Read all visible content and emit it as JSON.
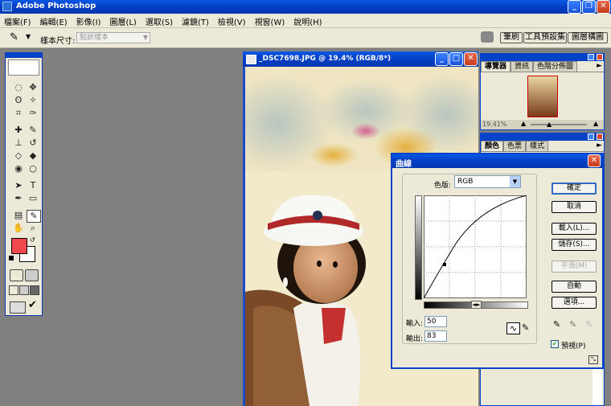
{
  "app": {
    "title": "Adobe Photoshop"
  },
  "menu": [
    "檔案(F)",
    "編輯(E)",
    "影像(I)",
    "圖層(L)",
    "選取(S)",
    "濾鏡(T)",
    "檢視(V)",
    "視窗(W)",
    "說明(H)"
  ],
  "options": {
    "sample_label": "樣本尺寸:",
    "sample_value": "點狀樣本",
    "tab_brush": "筆刷",
    "tab_presets": "工具預設集",
    "tab_comps": "圖層構圖"
  },
  "document": {
    "title": "_DSC7698.JPG @ 19.4% (RGB/8*)"
  },
  "navigator": {
    "tabs": [
      "導覽器",
      "資訊",
      "色階分佈圖"
    ],
    "zoom": "19.41%"
  },
  "color_panel": {
    "tabs": [
      "顏色",
      "色票",
      "樣式"
    ]
  },
  "curves": {
    "title": "曲線",
    "channel_label": "色版:",
    "channel_value": "RGB",
    "input_label": "輸入:",
    "input_value": "50",
    "output_label": "輸出:",
    "output_value": "83",
    "buttons": {
      "ok": "確定",
      "cancel": "取消",
      "load": "載入(L)...",
      "save": "儲存(S)...",
      "smooth": "平滑(M)",
      "auto": "自動",
      "options": "選項..."
    },
    "preview_label": "預視(P)",
    "preview_checked": true
  },
  "colors": {
    "foreground": "#f0484c",
    "background": "#ffffff",
    "accent": "#0442c8"
  }
}
